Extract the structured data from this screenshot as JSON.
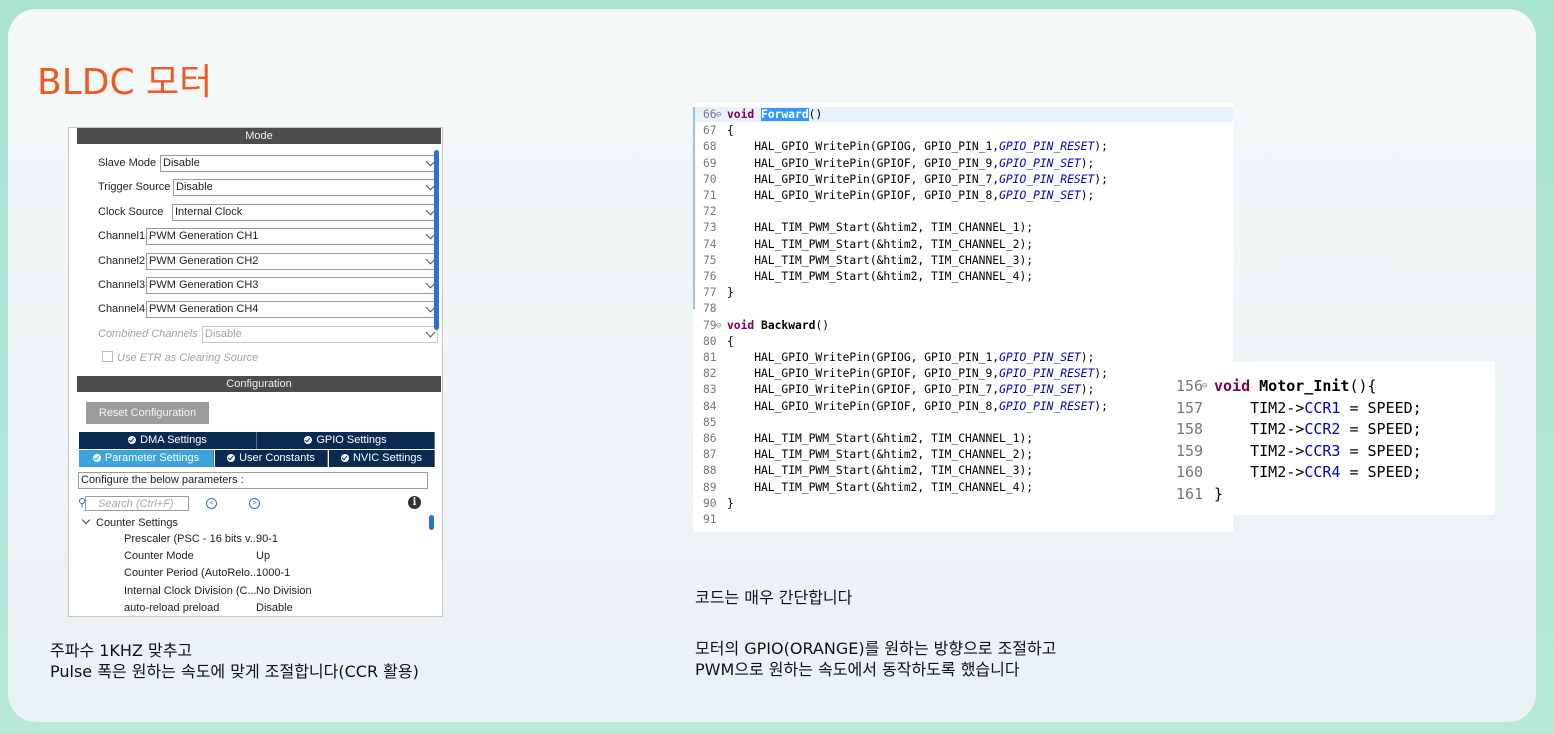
{
  "slide_title": "BLDC 모터",
  "cube": {
    "mode_header": "Mode",
    "mode_rows": [
      {
        "label": "Slave Mode",
        "value": "Disable",
        "dim": false
      },
      {
        "label": "Trigger Source",
        "value": "Disable",
        "dim": false
      },
      {
        "label": "Clock Source",
        "value": "Internal Clock",
        "dim": false
      },
      {
        "label": "Channel1",
        "value": "PWM Generation CH1",
        "dim": false
      },
      {
        "label": "Channel2",
        "value": "PWM Generation CH2",
        "dim": false
      },
      {
        "label": "Channel3",
        "value": "PWM Generation CH3",
        "dim": false
      },
      {
        "label": "Channel4",
        "value": "PWM Generation CH4",
        "dim": false
      },
      {
        "label": "Combined Channels",
        "value": "Disable",
        "dim": true
      }
    ],
    "use_etr_label": "Use ETR as Clearing Source",
    "config_header": "Configuration",
    "reset_button": "Reset Configuration",
    "tabs_row1": [
      "DMA Settings",
      "GPIO Settings"
    ],
    "tabs_row2": [
      "Parameter Settings",
      "User Constants",
      "NVIC Settings"
    ],
    "configure_text": "Configure the below parameters :",
    "search_placeholder": "Search (Ctrl+F)",
    "tree_group": "Counter Settings",
    "params": [
      {
        "name": "Prescaler (PSC - 16 bits v...",
        "value": "90-1"
      },
      {
        "name": "Counter Mode",
        "value": "Up"
      },
      {
        "name": "Counter Period (AutoRelo...",
        "value": "1000-1"
      },
      {
        "name": "Internal Clock Division (C...",
        "value": "No Division"
      },
      {
        "name": "auto-reload preload",
        "value": "Disable"
      }
    ]
  },
  "code_main": {
    "lines": [
      {
        "n": "66",
        "fold": true,
        "html": "<span class='kw'>void</span> <span class='sel-word'>Forward</span>()"
      },
      {
        "n": "67",
        "html": "{"
      },
      {
        "n": "68",
        "html": "    HAL_GPIO_WritePin(GPIOG, GPIO_PIN_1,<span class='it'>GPIO_PIN_RESET</span>);"
      },
      {
        "n": "69",
        "html": "    HAL_GPIO_WritePin(GPIOF, GPIO_PIN_9,<span class='it'>GPIO_PIN_SET</span>);"
      },
      {
        "n": "70",
        "html": "    HAL_GPIO_WritePin(GPIOF, GPIO_PIN_7,<span class='it'>GPIO_PIN_RESET</span>);"
      },
      {
        "n": "71",
        "html": "    HAL_GPIO_WritePin(GPIOF, GPIO_PIN_8,<span class='it'>GPIO_PIN_SET</span>);"
      },
      {
        "n": "72",
        "html": ""
      },
      {
        "n": "73",
        "html": "    HAL_TIM_PWM_Start(&amp;htim2, TIM_CHANNEL_1);"
      },
      {
        "n": "74",
        "html": "    HAL_TIM_PWM_Start(&amp;htim2, TIM_CHANNEL_2);"
      },
      {
        "n": "75",
        "html": "    HAL_TIM_PWM_Start(&amp;htim2, TIM_CHANNEL_3);"
      },
      {
        "n": "76",
        "html": "    HAL_TIM_PWM_Start(&amp;htim2, TIM_CHANNEL_4);"
      },
      {
        "n": "77",
        "html": "}"
      },
      {
        "n": "78",
        "html": ""
      },
      {
        "n": "79",
        "fold": true,
        "html": "<span class='kw'>void</span> <b>Backward</b>()"
      },
      {
        "n": "80",
        "html": "{"
      },
      {
        "n": "81",
        "html": "    HAL_GPIO_WritePin(GPIOG, GPIO_PIN_1,<span class='it'>GPIO_PIN_SET</span>);"
      },
      {
        "n": "82",
        "html": "    HAL_GPIO_WritePin(GPIOF, GPIO_PIN_9,<span class='it'>GPIO_PIN_RESET</span>);"
      },
      {
        "n": "83",
        "html": "    HAL_GPIO_WritePin(GPIOF, GPIO_PIN_7,<span class='it'>GPIO_PIN_SET</span>);"
      },
      {
        "n": "84",
        "html": "    HAL_GPIO_WritePin(GPIOF, GPIO_PIN_8,<span class='it'>GPIO_PIN_RESET</span>);"
      },
      {
        "n": "85",
        "html": ""
      },
      {
        "n": "86",
        "html": "    HAL_TIM_PWM_Start(&amp;htim2, TIM_CHANNEL_1);"
      },
      {
        "n": "87",
        "html": "    HAL_TIM_PWM_Start(&amp;htim2, TIM_CHANNEL_2);"
      },
      {
        "n": "88",
        "html": "    HAL_TIM_PWM_Start(&amp;htim2, TIM_CHANNEL_3);"
      },
      {
        "n": "89",
        "html": "    HAL_TIM_PWM_Start(&amp;htim2, TIM_CHANNEL_4);"
      },
      {
        "n": "90",
        "html": "}"
      },
      {
        "n": "91",
        "html": ""
      }
    ]
  },
  "code_init": {
    "lines": [
      {
        "n": "156",
        "fold": true,
        "html": "<span class='kw'>void</span> <b>Motor_Init</b>(){"
      },
      {
        "n": "157",
        "html": "    TIM2-><span class='fld'>CCR1</span> = SPEED;"
      },
      {
        "n": "158",
        "html": "    TIM2-><span class='fld'>CCR2</span> = SPEED;"
      },
      {
        "n": "159",
        "html": "    TIM2-><span class='fld'>CCR3</span> = SPEED;"
      },
      {
        "n": "160",
        "html": "    TIM2-><span class='fld'>CCR4</span> = SPEED;"
      },
      {
        "n": "161",
        "html": "}"
      }
    ]
  },
  "notes": {
    "left_line1": "주파수 1KHZ 맞추고",
    "left_line2": "Pulse 폭은  원하는 속도에 맞게 조절합니다(CCR 활용)",
    "right_simple": "코드는 매우 간단합니다",
    "right_line1": "모터의 GPIO(ORANGE)를 원하는 방향으로 조절하고",
    "right_line2": "PWM으로 원하는 속도에서 동작하도록 했습니다"
  },
  "colors": {
    "title": "#ef5a24",
    "tab_dark": "#0b2a52",
    "tab_active": "#3ba5db",
    "keyword": "#7f0055",
    "constant": "#0000c0"
  }
}
